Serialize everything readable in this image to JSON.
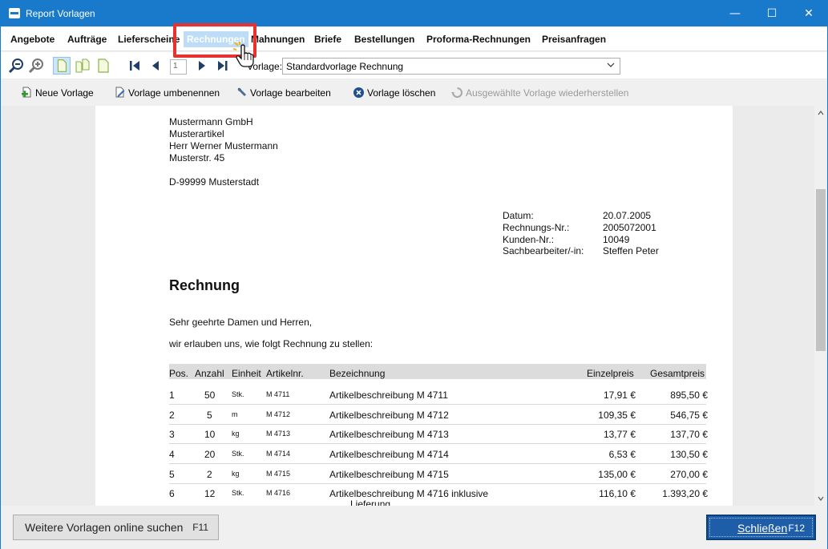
{
  "window": {
    "title": "Report Vorlagen",
    "controls": {
      "minimize": "—",
      "maximize": "☐",
      "close": "✕"
    }
  },
  "tabs": [
    {
      "label": "Angebote"
    },
    {
      "label": "Aufträge"
    },
    {
      "label": "Lieferscheine"
    },
    {
      "label": "Rechnungen",
      "active": true
    },
    {
      "label": "Mahnungen"
    },
    {
      "label": "Briefe"
    },
    {
      "label": "Bestellungen"
    },
    {
      "label": "Proforma-Rechnungen"
    },
    {
      "label": "Preisanfragen"
    }
  ],
  "navbar": {
    "page_number": "1",
    "vorlage_label": "Vorlage:",
    "vorlage_value": "Standardvorlage Rechnung",
    "icons": [
      "zoom-out-icon",
      "zoom-in-icon",
      "single-page-icon",
      "two-pages-icon",
      "page-width-icon",
      "first-page-icon",
      "previous-page-icon",
      "next-page-icon",
      "last-page-icon"
    ]
  },
  "actions": {
    "new": "Neue Vorlage",
    "rename": "Vorlage umbenennen",
    "edit": "Vorlage bearbeiten",
    "delete": "Vorlage löschen",
    "restore": "Ausgewählte Vorlage wiederherstellen"
  },
  "document": {
    "address": [
      "Mustermann GmbH",
      "Musterartikel",
      "Herr Werner Mustermann",
      "Musterstr. 45",
      "D-99999 Musterstadt"
    ],
    "meta": [
      {
        "label": "Datum:",
        "value": "20.07.2005"
      },
      {
        "label": "Rechnungs-Nr.:",
        "value": "2005072001"
      },
      {
        "label": "Kunden-Nr.:",
        "value": "10049"
      },
      {
        "label": "Sachbearbeiter/-in:",
        "value": "Steffen Peter"
      }
    ],
    "heading": "Rechnung",
    "greeting": "Sehr geehrte Damen und Herren,",
    "intro": "wir erlauben uns, wie folgt Rechnung zu stellen:",
    "columns": {
      "pos": "Pos.",
      "qty": "Anzahl",
      "unit": "Einheit",
      "art": "Artikelnr.",
      "desc": "Bezeichnung",
      "unit_price": "Einzelpreis",
      "total": "Gesamtpreis"
    },
    "rows": [
      {
        "pos": "1",
        "qty": "50",
        "unit": "Stk.",
        "art": "M 4711",
        "desc": "Artikelbeschreibung  M 4711",
        "unit_price": "17,91 €",
        "total": "895,50 €"
      },
      {
        "pos": "2",
        "qty": "5",
        "unit": "m",
        "art": "M 4712",
        "desc": "Artikelbeschreibung  M 4712",
        "unit_price": "109,35 €",
        "total": "546,75 €"
      },
      {
        "pos": "3",
        "qty": "10",
        "unit": "kg",
        "art": "M 4713",
        "desc": "Artikelbeschreibung  M 4713",
        "unit_price": "13,77 €",
        "total": "137,70 €"
      },
      {
        "pos": "4",
        "qty": "20",
        "unit": "Stk.",
        "art": "M 4714",
        "desc": "Artikelbeschreibung M 4714",
        "unit_price": "6,53 €",
        "total": "130,50 €"
      },
      {
        "pos": "5",
        "qty": "2",
        "unit": "kg",
        "art": "M 4715",
        "desc": "Artikelbeschreibung M 4715",
        "unit_price": "135,00 €",
        "total": "270,00 €"
      },
      {
        "pos": "6",
        "qty": "12",
        "unit": "Stk.",
        "art": "M 4716",
        "desc": "Artikelbeschreibung M 4716 inklusive",
        "desc2": "Lieferung",
        "unit_price": "116,10 €",
        "total": "1.393,20 €"
      }
    ]
  },
  "footer": {
    "more_label": "Weitere Vorlagen online suchen",
    "more_key": "F11",
    "close_label": "Schließen",
    "close_key": "F12"
  },
  "colors": {
    "accent": "#1979ca",
    "highlight": "#e8322f",
    "primary_button": "#1e5ea8"
  }
}
